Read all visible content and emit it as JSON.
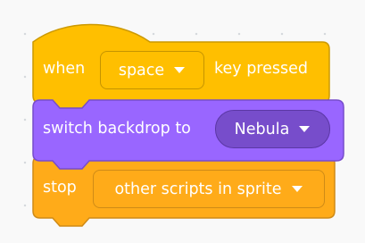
{
  "workspace": {
    "colors": {
      "background": "#f9f9f9",
      "events_block": "#ffbf00",
      "events_border": "#cc9900",
      "looks_block": "#9966ff",
      "looks_border": "#774dcb",
      "control_block": "#ffab19",
      "control_border": "#cf8b17",
      "text": "#ffffff"
    }
  },
  "blocks": {
    "event_hat": {
      "label_before": "when",
      "key_dropdown": {
        "value": "space",
        "icon": "caret-down-icon"
      },
      "label_after": "key pressed"
    },
    "switch_backdrop": {
      "label": "switch backdrop to",
      "backdrop_dropdown": {
        "value": "Nebula",
        "icon": "caret-down-icon"
      }
    },
    "stop": {
      "label": "stop",
      "option_dropdown": {
        "value": "other scripts in sprite",
        "icon": "caret-down-icon"
      }
    }
  }
}
